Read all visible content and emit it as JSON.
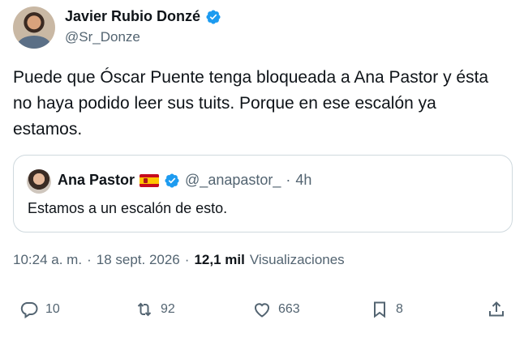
{
  "author": {
    "display_name": "Javier Rubio Donzé",
    "handle": "@Sr_Donze"
  },
  "tweet": {
    "text": "Puede que Óscar Puente tenga bloqueada a Ana Pastor y ésta no haya podido leer sus tuits. Porque en ese escalón ya estamos."
  },
  "quoted": {
    "display_name": "Ana Pastor",
    "handle": "@_anapastor_",
    "separator": "·",
    "time": "4h",
    "text": "Estamos a un escalón de esto."
  },
  "meta": {
    "time": "10:24 a. m.",
    "sep1": "·",
    "date": "18 sept. 2026",
    "sep2": "·",
    "views_count": "12,1 mil",
    "views_label": "Visualizaciones"
  },
  "actions": {
    "replies": "10",
    "retweets": "92",
    "likes": "663",
    "bookmarks": "8"
  },
  "colors": {
    "verified": "#1d9bf0",
    "secondary_text": "#536471",
    "primary_text": "#0f1419",
    "border": "#cfd9de"
  },
  "icons": [
    "verified-badge-icon",
    "reply-icon",
    "retweet-icon",
    "like-icon",
    "bookmark-icon",
    "share-icon",
    "spain-flag-icon"
  ]
}
